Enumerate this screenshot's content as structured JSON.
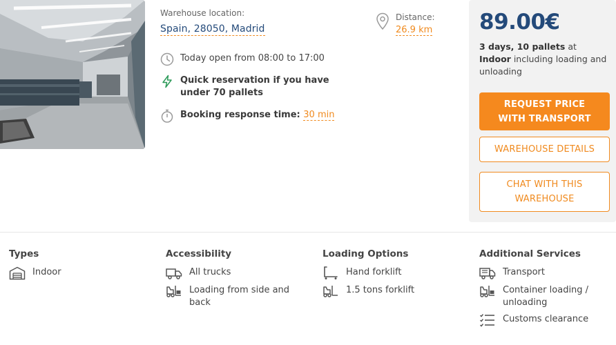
{
  "location": {
    "label": "Warehouse location:",
    "value": "Spain, 28050, Madrid"
  },
  "features": [
    {
      "icon": "clock-icon",
      "text": "Today open from 08:00 to 17:00"
    },
    {
      "icon": "lightning-icon",
      "text": "Quick reservation if you have under 70 pallets"
    },
    {
      "icon": "stopwatch-icon",
      "text": "Booking response time:",
      "value": "30 min"
    }
  ],
  "distance": {
    "label": "Distance:",
    "value": "26.9 km"
  },
  "price": {
    "amount": "89.00€",
    "summary_part1": "3 days, 10 pallets",
    "summary_part2": " at ",
    "summary_part3": "Indoor",
    "summary_part4": " including loading and unloading"
  },
  "buttons": {
    "request": "REQUEST PRICE WITH TRANSPORT",
    "details": "WAREHOUSE DETAILS",
    "chat": "CHAT WITH THIS WAREHOUSE"
  },
  "attributes": {
    "types": {
      "title": "Types",
      "items": [
        {
          "icon": "warehouse-icon",
          "text": "Indoor"
        }
      ]
    },
    "accessibility": {
      "title": "Accessibility",
      "items": [
        {
          "icon": "truck-icon",
          "text": "All trucks"
        },
        {
          "icon": "forklift-icon",
          "text": "Loading from side and back"
        }
      ]
    },
    "loading": {
      "title": "Loading Options",
      "items": [
        {
          "icon": "hand-forklift-icon",
          "text": "Hand forklift"
        },
        {
          "icon": "forklift-icon",
          "text": "1.5 tons forklift"
        }
      ]
    },
    "services": {
      "title": "Additional Services",
      "items": [
        {
          "icon": "transport-truck-icon",
          "text": "Transport"
        },
        {
          "icon": "forklift-icon",
          "text": "Container loading / unloading"
        },
        {
          "icon": "checklist-icon",
          "text": "Customs clearance"
        }
      ]
    }
  },
  "colors": {
    "accent": "#f5891e",
    "brand": "#244a7a",
    "panel": "#f2f2f2",
    "icon_gray": "#999999",
    "icon_green": "#2e9b5a"
  }
}
